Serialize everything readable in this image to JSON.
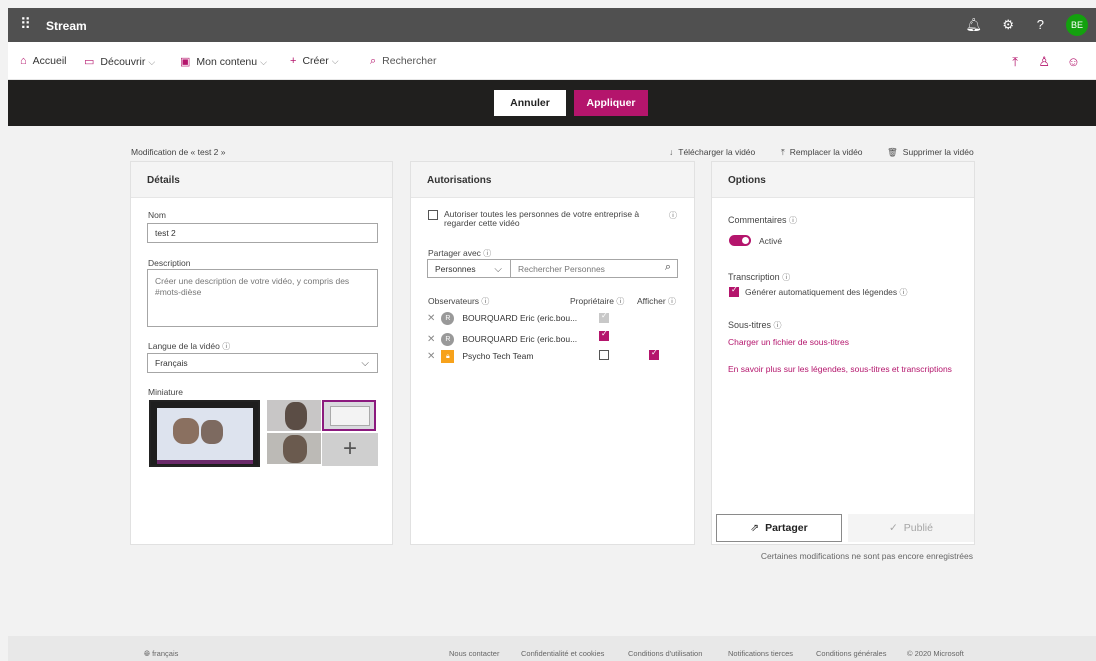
{
  "suitebar": {
    "app_name": "Stream",
    "waffle_icon": "waffle-icon",
    "icons": [
      "bell-icon",
      "gear-icon",
      "help-icon"
    ],
    "avatar_initials": "BE"
  },
  "nav": {
    "accueil": "Accueil",
    "decouvrir": "Découvrir",
    "mon_contenu": "Mon contenu",
    "creer": "Créer",
    "rechercher": "Rechercher"
  },
  "actions": {
    "annuler": "Annuler",
    "appliquer": "Appliquer"
  },
  "header": {
    "breadcrumb": "Modification de « test 2 »",
    "download": "Télécharger la vidéo",
    "replace": "Remplacer la vidéo",
    "delete": "Supprimer la vidéo"
  },
  "details": {
    "title": "Détails",
    "name_label": "Nom",
    "name_value": "test 2",
    "description_label": "Description",
    "description_placeholder": "Créer une description de votre vidéo, y compris des #mots-dièse",
    "language_label": "Langue de la vidéo",
    "language_value": "Français",
    "thumbnail_label": "Miniature"
  },
  "permissions": {
    "title": "Autorisations",
    "allow_company": "Autoriser toutes les personnes de votre entreprise à regarder cette vidéo",
    "share_with_label": "Partager avec",
    "share_type": "Personnes",
    "search_placeholder": "Rechercher Personnes",
    "observers_col": "Observateurs",
    "owner_col": "Propriétaire",
    "display_col": "Afficher",
    "rows": [
      {
        "name": "BOURQUARD Eric (eric.bou...",
        "initial": "R"
      },
      {
        "name": "BOURQUARD Eric (eric.bou...",
        "initial": "R"
      },
      {
        "name": "Psycho Tech Team",
        "initial": "🔒"
      }
    ]
  },
  "options": {
    "title": "Options",
    "comments_label": "Commentaires",
    "comments_state": "Activé",
    "transcription_label": "Transcription",
    "auto_captions": "Générer automatiquement des légendes",
    "subtitles_label": "Sous-titres",
    "upload_subtitles": "Charger un fichier de sous-titres",
    "learn_more": "En savoir plus sur les légendes, sous-titres et transcriptions",
    "share_button": "Partager",
    "published_button": "Publié"
  },
  "pending_note": "Certaines modifications ne sont pas encore enregistrées",
  "footer": {
    "language": "français",
    "contact": "Nous contacter",
    "privacy": "Confidentialité et cookies",
    "terms_use": "Conditions d'utilisation",
    "third_party": "Notifications tierces",
    "general_terms": "Conditions générales",
    "copyright": "© 2020 Microsoft"
  },
  "colors": {
    "accent": "#b4156c",
    "suitebar": "#505050",
    "actionbar": "#201f1e",
    "avatar": "#13a10e"
  }
}
